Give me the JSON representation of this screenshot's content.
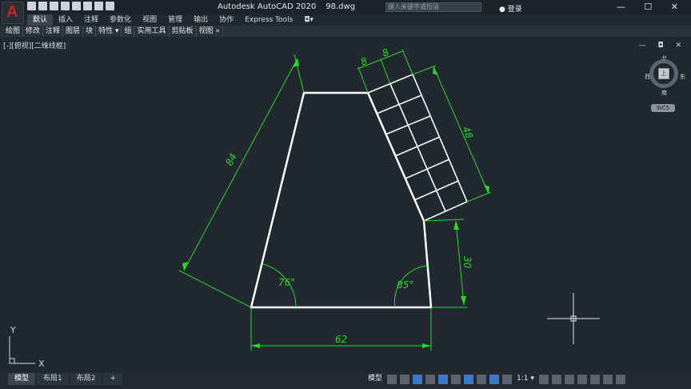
{
  "app": {
    "title": "Autodesk AutoCAD 2020",
    "file": "98.dwg",
    "logo": "A",
    "search_placeholder": "键入关键字或短语",
    "login_label": "登录",
    "window_controls": "— ☐ ✕"
  },
  "ribbon": {
    "tabs": [
      "默认",
      "插入",
      "注释",
      "参数化",
      "视图",
      "管理",
      "输出",
      "协作",
      "Express Tools",
      "◘▾"
    ],
    "active": 0
  },
  "menubar": {
    "items": [
      "绘图",
      "修改",
      "注释",
      "图层",
      "块",
      "特性 ▾",
      "组",
      "实用工具",
      "剪贴板",
      "视图 »"
    ]
  },
  "viewport": {
    "label": "[-][俯视][二维线框]",
    "controls": "— ◘ ✕"
  },
  "viewcube": {
    "north": "北",
    "south": "南",
    "west": "西",
    "east": "东",
    "face": "上",
    "wcs": "WCS"
  },
  "drawing": {
    "dims": {
      "top_left": "84",
      "cell_a": "8",
      "cell_b": "8",
      "right_long": "48",
      "right_short": "30",
      "bottom": "62",
      "angle_left": "76°",
      "angle_right": "85°"
    },
    "ucs": {
      "x": "X",
      "y": "Y"
    },
    "colors": {
      "geometry": "#ffffff",
      "dimension": "#2bd62b",
      "background": "#212830"
    }
  },
  "layout_tabs": [
    "模型",
    "布局1",
    "布局2",
    "+"
  ],
  "status": {
    "model": "模型",
    "scale": "1:1 ▾"
  }
}
